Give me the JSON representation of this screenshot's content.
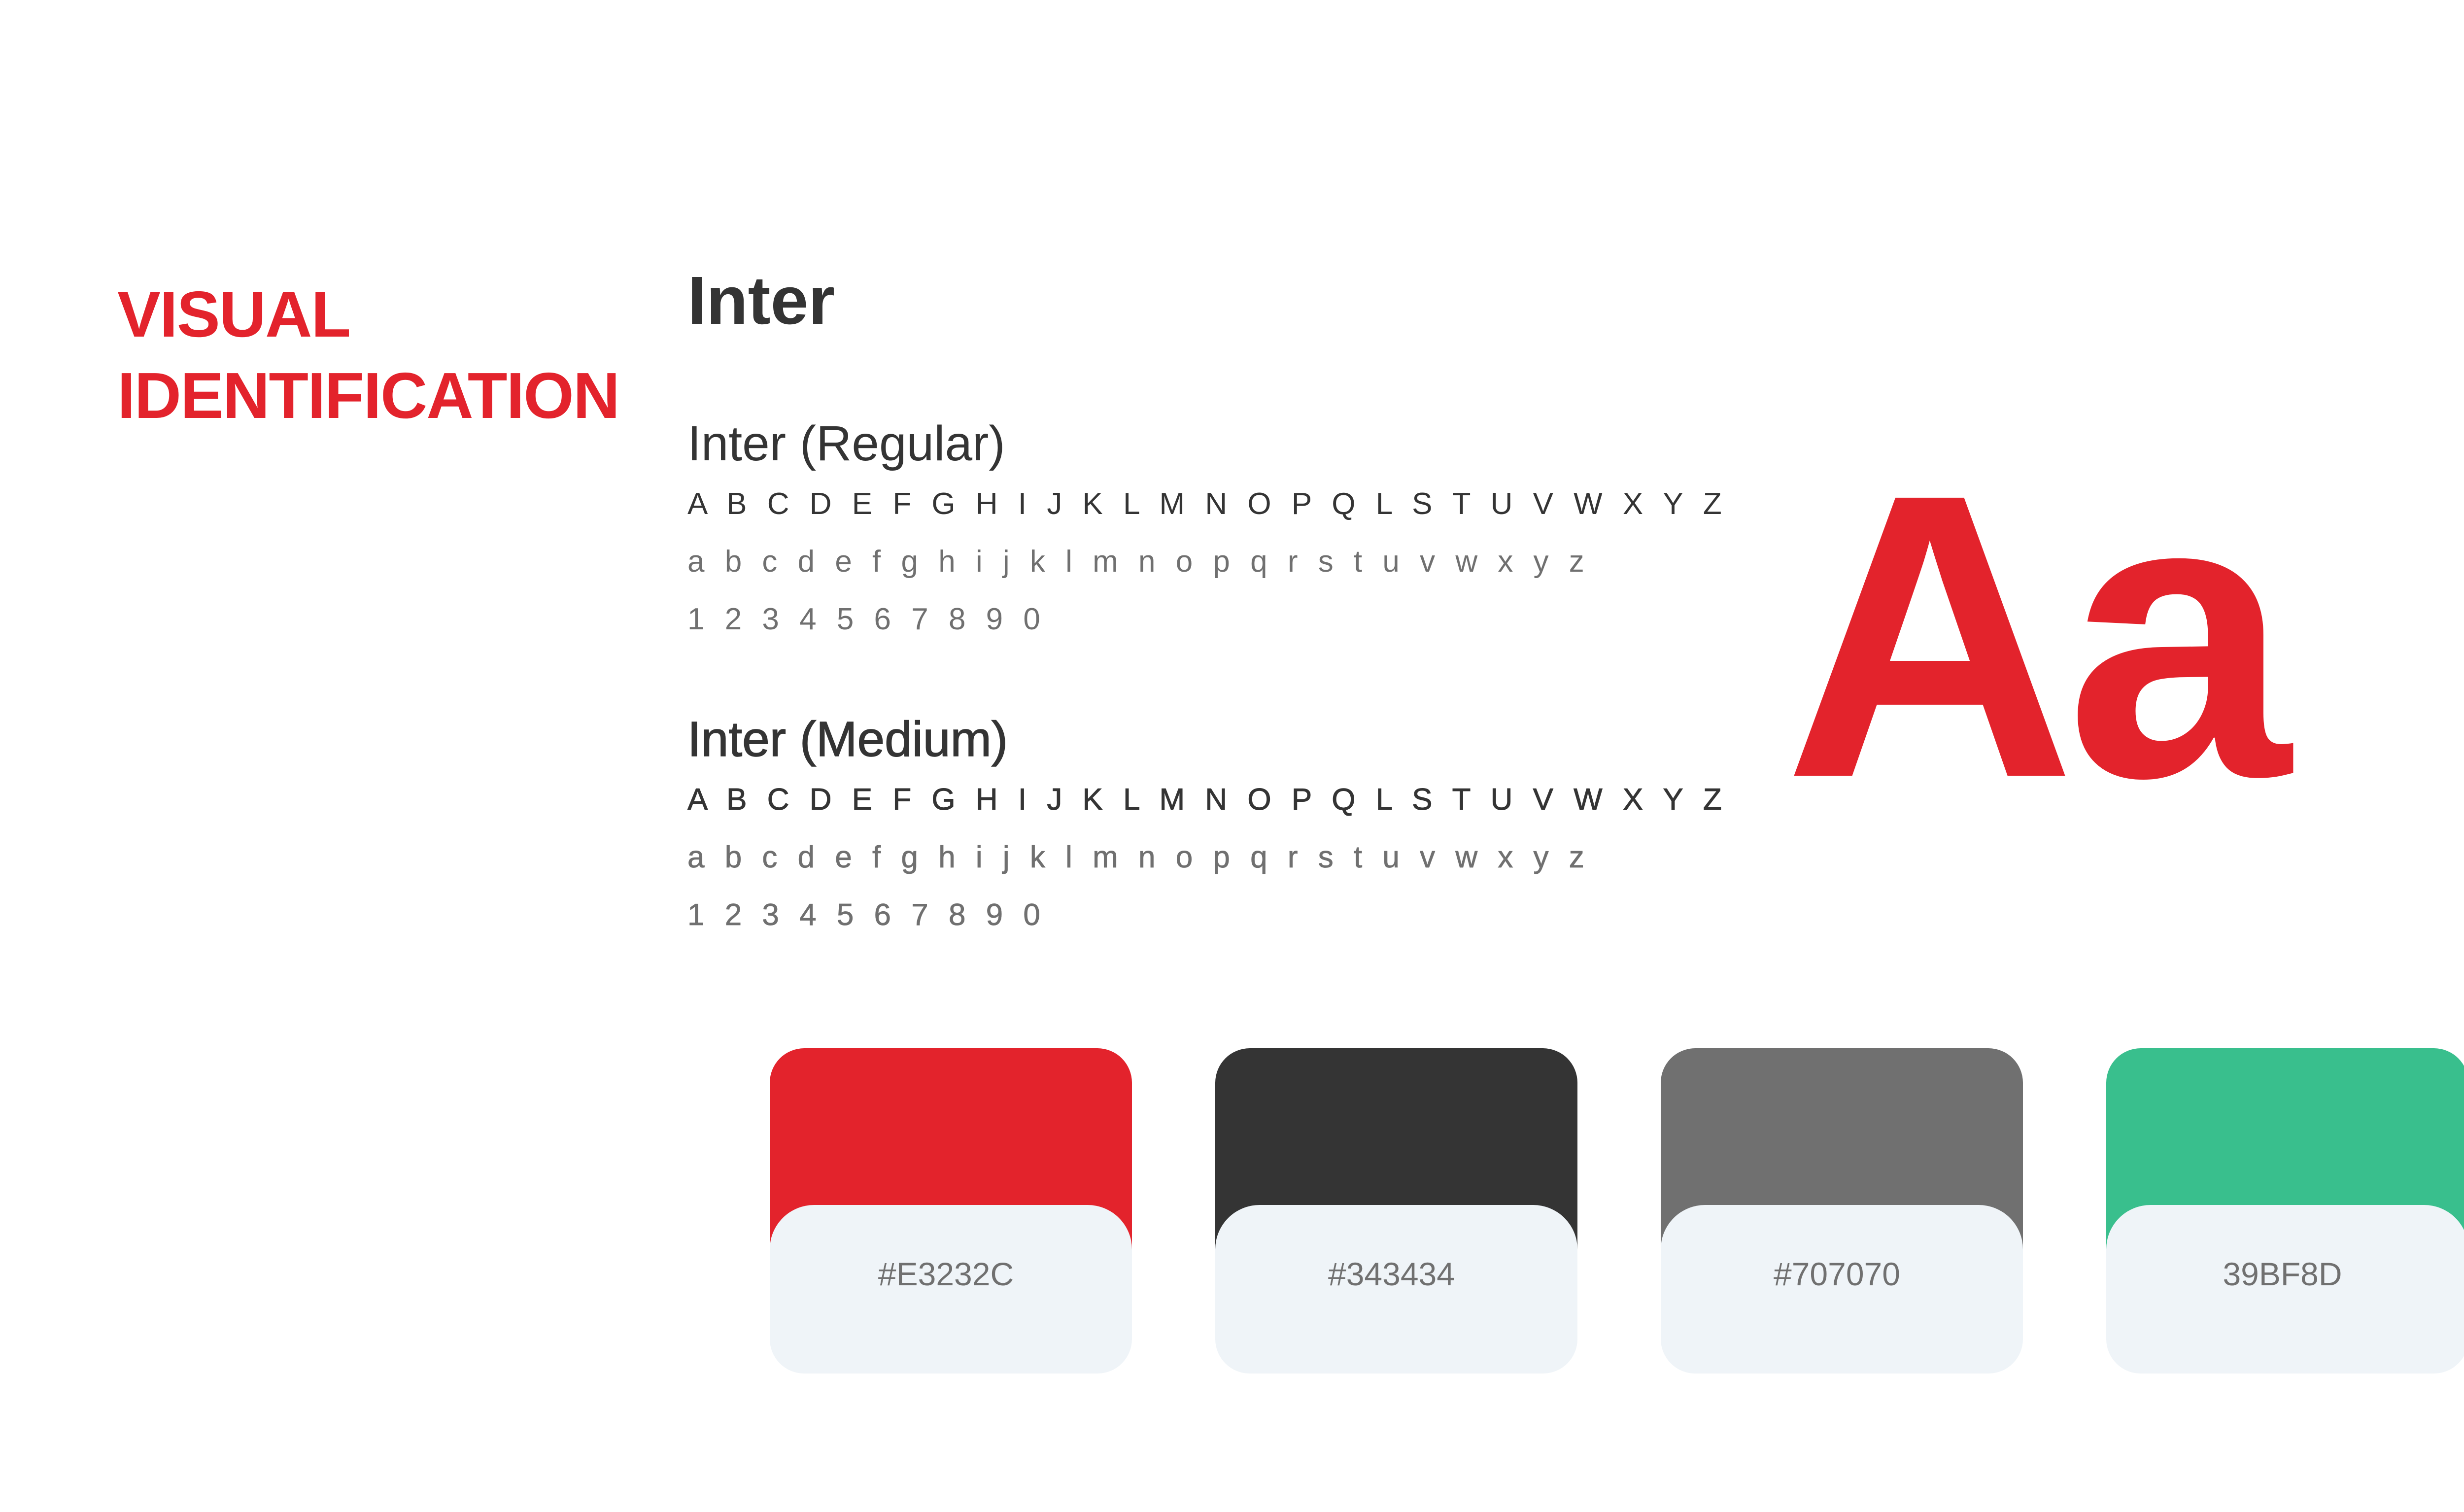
{
  "section_title": {
    "line1": "VISUAL",
    "line2": "IDENTIFICATION"
  },
  "typography": {
    "font_name": "Inter",
    "weights": [
      {
        "title": "Inter (Regular)",
        "uppercase": "A B C D E F G H I J K L M N O P Q L S T U V W X Y Z",
        "lowercase": "a b c d e f g h i j k l m n o p q r s t u v w x y z",
        "digits": "1 2 3 4 5 6 7 8 9 0"
      },
      {
        "title": "Inter (Medium)",
        "uppercase": "A B C D E F G H I J K L M N O P Q L S T U V W X Y Z",
        "lowercase": "a b c d e f g h i j k l m n o p q r s t u v w x y z",
        "digits": "1 2 3 4 5 6 7 8 9 0"
      }
    ],
    "sample": "Aa"
  },
  "palette": [
    {
      "label": "#E3232C",
      "color": "#E3232C"
    },
    {
      "label": "#343434",
      "color": "#343434"
    },
    {
      "label": "#707070",
      "color": "#707070"
    },
    {
      "label": "39BF8D",
      "color": "#39BF8D"
    }
  ],
  "colors": {
    "accent": "#E3232C",
    "text_dark": "#343434",
    "text_gray": "#707070",
    "label_background": "#EFF4F8"
  }
}
